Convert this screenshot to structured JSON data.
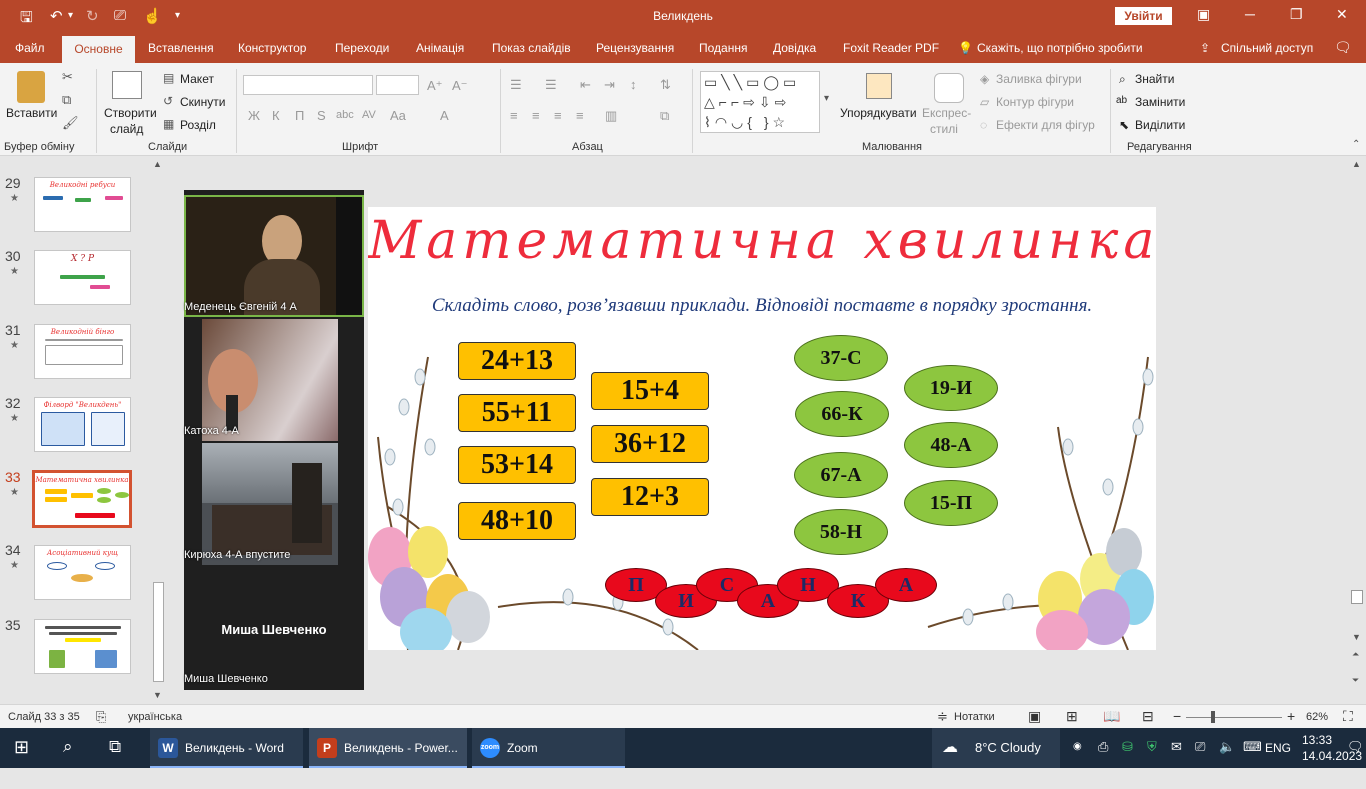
{
  "window": {
    "title": "Великдень",
    "signin": "Увійти",
    "qa_icons": [
      "save-icon",
      "undo-icon",
      "redo-icon",
      "present-icon",
      "touch-icon",
      "customize-icon"
    ]
  },
  "menu": {
    "tabs": [
      "Файл",
      "Основне",
      "Вставлення",
      "Конструктор",
      "Переходи",
      "Анімація",
      "Показ слайдів",
      "Рецензування",
      "Подання",
      "Довідка",
      "Foxit Reader PDF"
    ],
    "active": "Основне",
    "tellme": "Скажіть, що потрібно зробити",
    "share": "Спільний доступ"
  },
  "ribbon": {
    "groups": {
      "clipboard": "Буфер обміну",
      "slides": "Слайди",
      "font": "Шрифт",
      "paragraph": "Абзац",
      "drawing": "Малювання",
      "editing": "Редагування"
    },
    "paste": "Вставити",
    "new_slide_1": "Створити",
    "new_slide_2": "слайд",
    "layout": "Макет",
    "reset": "Скинути",
    "section": "Розділ",
    "arrange": "Упорядкувати",
    "quick_styles_1": "Експрес-",
    "quick_styles_2": "стилі",
    "shape_fill": "Заливка фігури",
    "shape_outline": "Контур фігури",
    "shape_effects": "Ефекти для фігур",
    "find": "Знайти",
    "replace": "Замінити",
    "select": "Виділити",
    "font_buttons": [
      "Ж",
      "К",
      "П",
      "S",
      "abc",
      "AV",
      "Aa",
      "A"
    ]
  },
  "thumbnails": [
    {
      "num": "29",
      "title": "Великодні ребуси",
      "star": "★"
    },
    {
      "num": "30",
      "title": "Х ? Р",
      "star": "★"
    },
    {
      "num": "31",
      "title": "Великодній бінго",
      "star": "★"
    },
    {
      "num": "32",
      "title": "Філворд \"Великдень\"",
      "star": "★"
    },
    {
      "num": "33",
      "title": "Математична хвилинка",
      "star": "★",
      "selected": true
    },
    {
      "num": "34",
      "title": "Асоціативний кущ",
      "star": "★"
    },
    {
      "num": "35",
      "title": "",
      "star": ""
    }
  ],
  "zoom": {
    "participants": [
      "Меденець Євгеній 4 А",
      "Катоха 4-А",
      "Кирюха 4-А впустите",
      "Миша Шевченко"
    ],
    "big_name": "Миша Шевченко"
  },
  "slide": {
    "title": "Математична хвилинка",
    "subtitle": "Складіть слово, розв’язавши приклади. Відповіді поставте в порядку зростання.",
    "examples_col1": [
      "24+13",
      "55+11",
      "53+14",
      "48+10"
    ],
    "examples_col2": [
      "15+4",
      "36+12",
      "12+3"
    ],
    "answers_col1": [
      "37-С",
      "66-К",
      "67-А",
      "58-Н"
    ],
    "answers_col2": [
      "19-И",
      "48-А",
      "15-П"
    ],
    "word_letters": [
      "П",
      "И",
      "С",
      "А",
      "Н",
      "К",
      "А"
    ]
  },
  "status": {
    "slide_info": "Слайд 33 з 35",
    "language": "українська",
    "notes": "Нотатки",
    "zoom": "62%"
  },
  "taskbar": {
    "apps": [
      {
        "label": "Великдень - Word",
        "icon": "word-icon",
        "color": "#2b579a"
      },
      {
        "label": "Великдень - Power...",
        "icon": "powerpoint-icon",
        "color": "#c43e1c"
      },
      {
        "label": "Zoom",
        "icon": "zoom-icon",
        "color": "#2d8cff"
      }
    ],
    "weather": "8°C  Cloudy",
    "lang": "ENG",
    "time": "13:33",
    "date": "14.04.2023"
  }
}
